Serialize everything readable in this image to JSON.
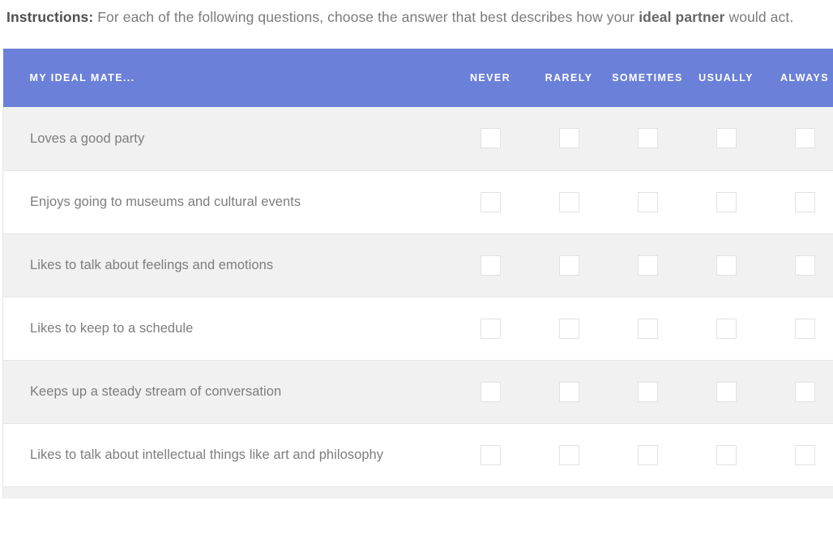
{
  "instructions": {
    "lead": "Instructions:",
    "body_before": " For each of the following questions, choose the answer that best describes how your ",
    "emphasis": "ideal partner",
    "body_after": " would act."
  },
  "matrix": {
    "row_header_label": "MY IDEAL MATE...",
    "scale_columns": [
      "NEVER",
      "RARELY",
      "SOMETIMES",
      "USUALLY",
      "ALWAYS"
    ],
    "statements": [
      "Loves a good party",
      "Enjoys going to museums and cultural events",
      "Likes to talk about feelings and emotions",
      "Likes to keep to a schedule",
      "Keeps up a steady stream of conversation",
      "Likes to talk about intellectual things like art and philosophy"
    ]
  },
  "colors": {
    "header_background": "#6b80d8",
    "header_text": "#ffffff",
    "row_odd_background": "#f1f1f1",
    "row_even_background": "#ffffff",
    "statement_text": "#7d7d7d",
    "instruction_text": "#7b7b7b",
    "checkbox_border": "#e2e2e2",
    "row_divider": "#e6e6e6"
  }
}
